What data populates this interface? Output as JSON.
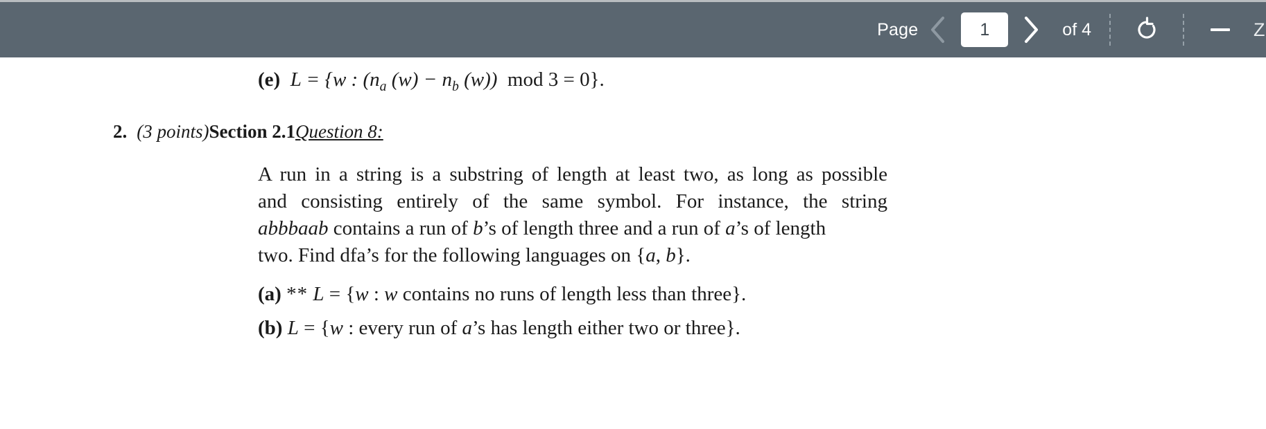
{
  "toolbar": {
    "page_label": "Page",
    "prev_icon": "chevron-left-icon",
    "page_value": "1",
    "next_icon": "chevron-right-icon",
    "of_label": "of 4",
    "rotate_icon": "rotate-icon",
    "zoom_out_icon": "minus-icon",
    "zoom_label": "Z",
    "bg_color": "#5a6670",
    "accent_color": "#ffffff"
  },
  "document": {
    "item_e": {
      "label": "(e)",
      "formula_prefix": "L = {w : (n",
      "sub_a": "a",
      "mid1": " (w) − n",
      "sub_b": "b",
      "mid2": " (w))",
      "mod_text": "mod",
      "formula_suffix": "3 = 0}."
    },
    "question_heading": {
      "number": "2.",
      "points": "(3 points)",
      "section": "Section 2.1",
      "question": "Question 8:"
    },
    "paragraph": {
      "line1": "A run in a string is a substring of length at least two, as long as possible",
      "line2": "and consisting entirely of the same symbol.  For instance, the string",
      "line3_italic": "abbbaab",
      "line3_rest_a": " contains a run of ",
      "line3_b": "b",
      "line3_rest_b": "’s of length three and a run of ",
      "line3_a": "a",
      "line3_rest_c": "’s of length",
      "line4_pre": "two.  Find dfa’s for the following languages on {",
      "line4_a": "a",
      "line4_comma": ", ",
      "line4_b": "b",
      "line4_post": "}."
    },
    "subitems": [
      {
        "label": "(a)",
        "stars": "**",
        "math_l": "L",
        "eq": " = {",
        "math_w1": "w",
        "colon": " : ",
        "math_w2": "w",
        "text": " contains no runs of length less than three}."
      },
      {
        "label": "(b)",
        "stars": "",
        "math_l": "L",
        "eq": " = {",
        "math_w1": "w",
        "colon": " :  every run of ",
        "math_w2": "a",
        "text": "’s has length either two or three}."
      }
    ]
  }
}
